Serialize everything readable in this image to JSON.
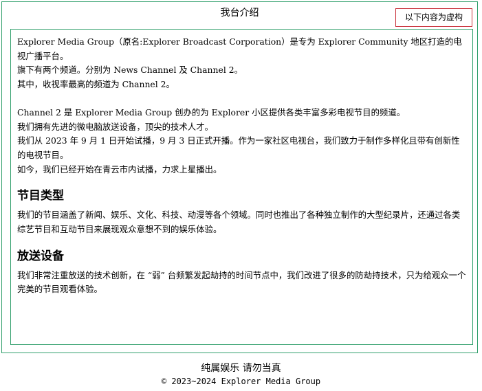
{
  "header": {
    "title": "我台介绍",
    "notice": "以下内容为虚构"
  },
  "intro": {
    "lines": [
      "Explorer Media Group（原名:Explorer Broadcast Corporation）是专为 Explorer Community 地区打造的电视广播平台。",
      "旗下有两个频道。分别为 News Channel 及 Channel 2。",
      "其中，收视率最高的频道为 Channel 2。"
    ]
  },
  "channel2": {
    "lines": [
      "Channel 2 是 Explorer Media Group 创办的为 Explorer 小区提供各类丰富多彩电视节目的频道。",
      "我们拥有先进的微电脑放送设备，顶尖的技术人才。",
      "我们从 2023 年 9 月 1 日开始试播，9 月 3 日正式开播。作为一家社区电视台，我们致力于制作多样化且带有创新性的电视节目。",
      "如今，我们已经开始在青云市内试播，力求上星播出。"
    ]
  },
  "programs": {
    "heading": "节目类型",
    "text": "我们的节目涵盖了新闻、娱乐、文化、科技、动漫等各个领域。同时也推出了各种独立制作的大型纪录片，还通过各类综艺节目和互动节目来展现观众意想不到的娱乐体验。"
  },
  "equipment": {
    "heading": "放送设备",
    "text": "我们非常注重放送的技术创新，在 “弱” 台频繁发起劫持的时间节点中，我们改进了很多的防劫持技术，只为给观众一个完美的节目观看体验。"
  },
  "footer": {
    "slogan": "纯属娱乐 请勿当真",
    "copyright": "© 2023~2024 Explorer Media Group"
  },
  "colors": {
    "frame_border": "#2e9e6a",
    "notice_border": "#c8303a"
  }
}
